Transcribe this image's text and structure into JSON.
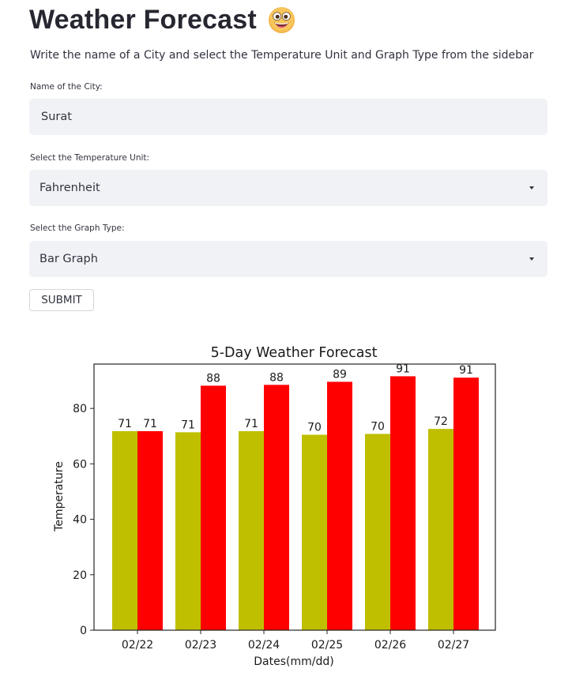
{
  "header": {
    "title": "Weather Forecast",
    "subtitle": "Write the name of a City and select the Temperature Unit and Graph Type from the sidebar"
  },
  "form": {
    "city": {
      "label": "Name of the City:",
      "value": "Surat"
    },
    "unit": {
      "label": "Select the Temperature Unit:",
      "value": "Fahrenheit"
    },
    "graph": {
      "label": "Select the Graph Type:",
      "value": "Bar Graph"
    },
    "submit_label": "SUBMIT"
  },
  "colors": {
    "background": "#ffffff",
    "field_bg": "#f0f2f6",
    "text": "#31333f",
    "series_a": "#bfbf00",
    "series_b": "#ff0000"
  },
  "chart_data": {
    "type": "bar",
    "title": "5-Day Weather Forecast",
    "xlabel": "Dates(mm/dd)",
    "ylabel": "Temperature",
    "ylim": [
      0,
      96
    ],
    "yticks": [
      0,
      20,
      40,
      60,
      80
    ],
    "categories": [
      "02/22",
      "02/23",
      "02/24",
      "02/25",
      "02/26",
      "02/27"
    ],
    "series": [
      {
        "color": "#bfbf00",
        "values": [
          71.8,
          71.4,
          71.8,
          70.5,
          70.8,
          72.6
        ],
        "labels": [
          "71",
          "71",
          "71",
          "70",
          "70",
          "72"
        ]
      },
      {
        "color": "#ff0000",
        "values": [
          71.8,
          88.2,
          88.5,
          89.6,
          91.6,
          91.1
        ],
        "labels": [
          "71",
          "88",
          "88",
          "89",
          "91",
          "91"
        ]
      }
    ],
    "grid": false,
    "legend": "none"
  }
}
